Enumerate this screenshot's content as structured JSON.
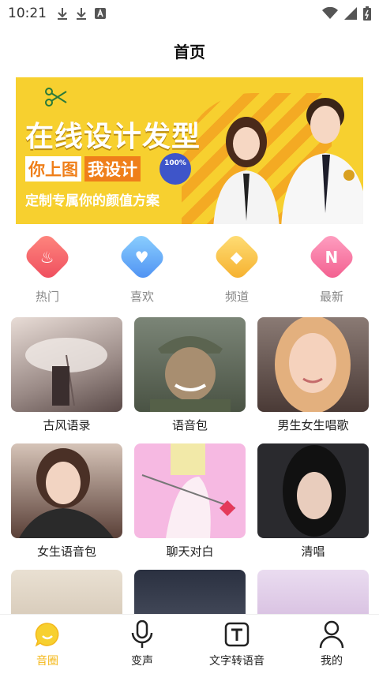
{
  "status": {
    "time": "10:21"
  },
  "header": {
    "title": "首页"
  },
  "banner": {
    "headline": "在线设计发型",
    "tag_a": "你上图",
    "tag_b": "我设计",
    "seal": "100%",
    "sub": "定制专属你的颜值方案"
  },
  "categories": [
    {
      "label": "热门",
      "icon": "flame-icon",
      "color": "#f05a5a"
    },
    {
      "label": "喜欢",
      "icon": "heart-icon",
      "color": "#5aa8f4"
    },
    {
      "label": "频道",
      "icon": "tag-icon",
      "color": "#f5c23a"
    },
    {
      "label": "最新",
      "icon": "new-badge-icon",
      "color": "#f4729a"
    }
  ],
  "tiles": [
    {
      "label": "古风语录"
    },
    {
      "label": "语音包"
    },
    {
      "label": "男生女生唱歌"
    },
    {
      "label": "女生语音包"
    },
    {
      "label": "聊天对白"
    },
    {
      "label": "清唱"
    },
    {
      "label": ""
    },
    {
      "label": ""
    },
    {
      "label": ""
    }
  ],
  "tabs": [
    {
      "label": "音圈",
      "icon": "chat-bubble-icon",
      "active": true
    },
    {
      "label": "变声",
      "icon": "microphone-icon"
    },
    {
      "label": "文字转语音",
      "icon": "text-t-icon"
    },
    {
      "label": "我的",
      "icon": "person-icon"
    }
  ],
  "colors": {
    "accent": "#f4b81a",
    "banner_bg": "#f7d02f"
  }
}
